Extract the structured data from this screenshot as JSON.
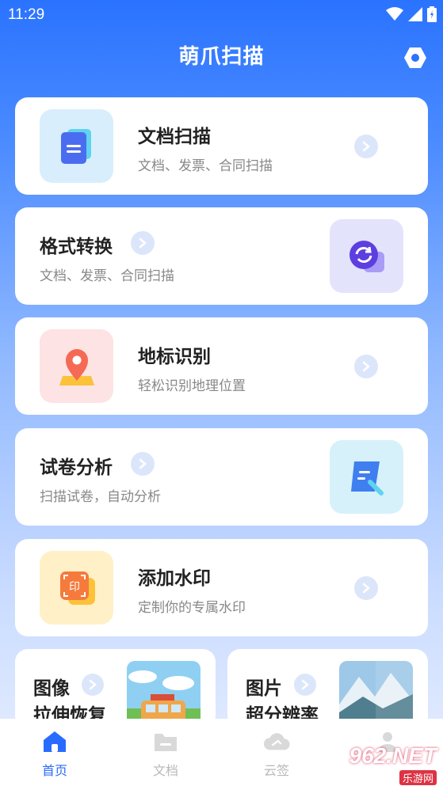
{
  "status": {
    "time": "11:29"
  },
  "header": {
    "title": "萌爪扫描"
  },
  "cards": [
    {
      "title": "文档扫描",
      "subtitle": "文档、发票、合同扫描",
      "icon": "document-icon"
    },
    {
      "title": "格式转换",
      "subtitle": "文档、发票、合同扫描",
      "icon": "convert-icon"
    },
    {
      "title": "地标识别",
      "subtitle": "轻松识别地理位置",
      "icon": "location-pin-icon"
    },
    {
      "title": "试卷分析",
      "subtitle": "扫描试卷，自动分析",
      "icon": "scroll-icon"
    },
    {
      "title": "添加水印",
      "subtitle": "定制你的专属水印",
      "icon": "stamp-icon"
    }
  ],
  "small_cards": [
    {
      "line1": "图像",
      "line2": "拉伸恢复"
    },
    {
      "line1": "图片",
      "line2": "超分辨率"
    }
  ],
  "nav": [
    {
      "label": "首页",
      "active": true
    },
    {
      "label": "文档",
      "active": false
    },
    {
      "label": "云签",
      "active": false
    }
  ],
  "watermark": {
    "text": "962.NET",
    "sub": "乐游网"
  },
  "colors": {
    "accent": "#2a6bff",
    "header_bg": "#2a73ff"
  }
}
